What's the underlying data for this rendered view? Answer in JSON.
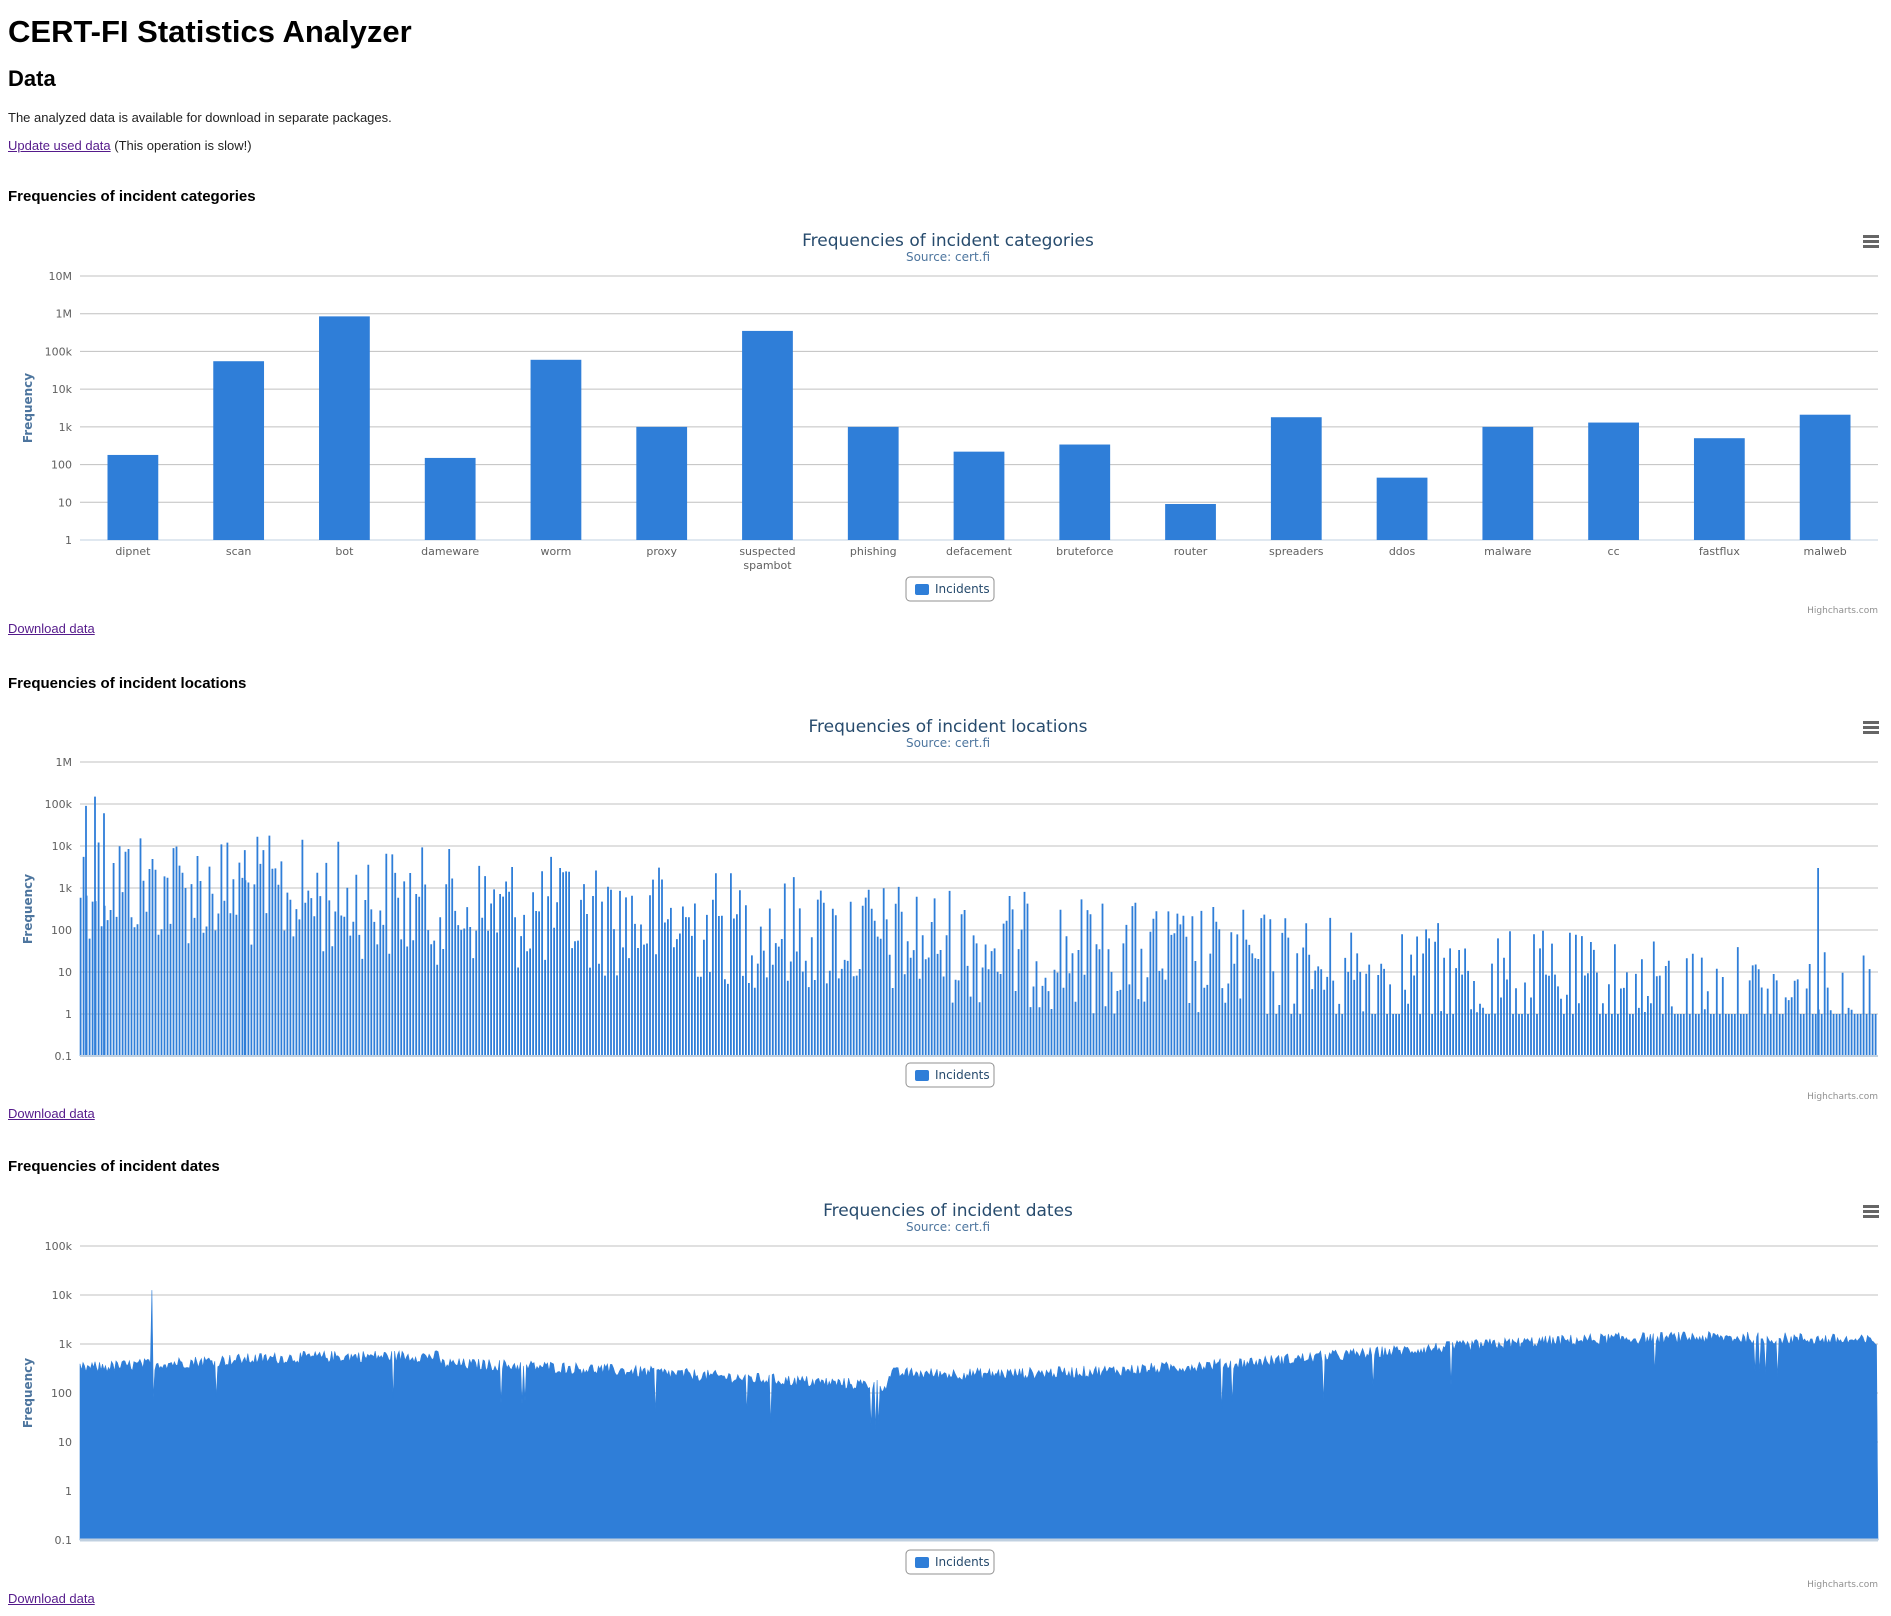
{
  "header": {
    "title": "CERT-FI Statistics Analyzer",
    "section": "Data",
    "intro": "The analyzed data is available for download in separate packages.",
    "update_link": "Update used data",
    "update_note": " (This operation is slow!)"
  },
  "colors": {
    "bar": "#2f7ed8",
    "title": "#274b6d",
    "subtitle": "#4d759e",
    "grid": "#c0c0c0"
  },
  "icons": {
    "menu": "menu-icon",
    "legend": "legend-swatch"
  },
  "sections": [
    {
      "heading": "Frequencies of incident categories",
      "download": "Download data"
    },
    {
      "heading": "Frequencies of incident locations",
      "download": "Download data"
    },
    {
      "heading": "Frequencies of incident dates",
      "download": "Download data"
    }
  ],
  "chart_data": [
    {
      "type": "bar",
      "title": "Frequencies of incident categories",
      "subtitle": "Source: cert.fi",
      "ylabel": "Frequency",
      "yscale": "log",
      "ylim": [
        1,
        10000000
      ],
      "yticks": [
        "1",
        "10",
        "100",
        "1k",
        "10k",
        "100k",
        "1M",
        "10M"
      ],
      "categories": [
        "dipnet",
        "scan",
        "bot",
        "dameware",
        "worm",
        "proxy",
        "suspected spambot",
        "phishing",
        "defacement",
        "bruteforce",
        "router",
        "spreaders",
        "ddos",
        "malware",
        "cc",
        "fastflux",
        "malweb"
      ],
      "series": [
        {
          "name": "Incidents",
          "values": [
            180,
            55000,
            850000,
            150,
            60000,
            1000,
            350000,
            1000,
            220,
            340,
            9,
            1800,
            45,
            1000,
            1300,
            500,
            2100
          ]
        }
      ],
      "legend": "bottom-center",
      "credits": "Highcharts.com",
      "grid": true
    },
    {
      "type": "bar",
      "title": "Frequencies of incident locations",
      "subtitle": "Source: cert.fi",
      "ylabel": "Frequency",
      "yscale": "log",
      "ylim": [
        0.1,
        1000000
      ],
      "yticks": [
        "0.1",
        "1",
        "10",
        "100",
        "1k",
        "10k",
        "100k",
        "1M"
      ],
      "series_name": "Incidents",
      "series_points": 600,
      "note": "Approximately 600 unlabeled location bars; values range from 1 to about 150k, decaying from left to right.",
      "legend": "bottom-center",
      "credits": "Highcharts.com",
      "grid": true
    },
    {
      "type": "area",
      "title": "Frequencies of incident dates",
      "subtitle": "Source: cert.fi",
      "ylabel": "Frequency",
      "yscale": "log",
      "ylim": [
        0.1,
        100000
      ],
      "yticks": [
        "0.1",
        "1",
        "10",
        "100",
        "1k",
        "10k",
        "100k"
      ],
      "series_name": "Incidents",
      "series_points": 1200,
      "note": "Dense daily series, values mostly 100–1k with one spike near 12k early on.",
      "legend": "bottom-center",
      "credits": "Highcharts.com",
      "grid": true
    }
  ]
}
